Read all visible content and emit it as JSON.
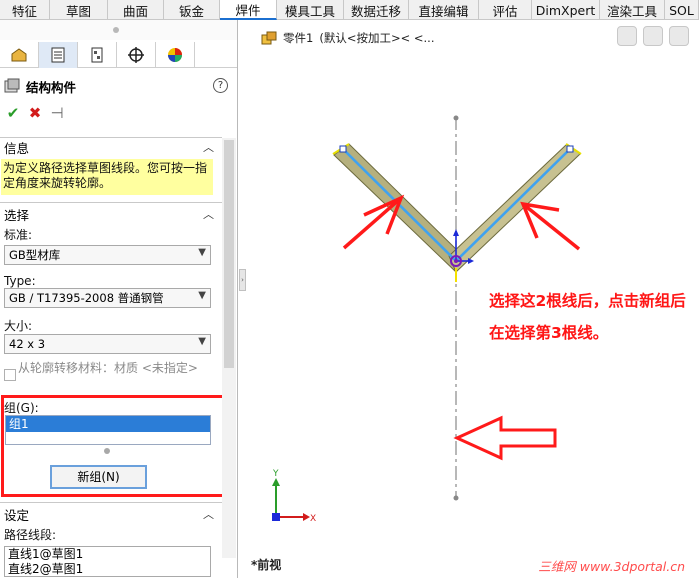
{
  "tabs": [
    "特征",
    "草图",
    "曲面",
    "钣金",
    "焊件",
    "模具工具",
    "数据迁移",
    "直接编辑",
    "评估",
    "DimXpert",
    "渲染工具",
    "SOL"
  ],
  "active_tab": "焊件",
  "property_manager": {
    "title": "结构构件",
    "help": "?",
    "ok": "✔",
    "cancel": "✖",
    "pin": "⊣",
    "info": {
      "header": "信息",
      "text": "为定义路径选择草图线段。您可按一指定角度来旋转轮廓。"
    },
    "selection": {
      "header": "选择",
      "standard_label": "标准:",
      "standard_value": "GB型材库",
      "type_label": "Type:",
      "type_value": "GB / T17395-2008 普通钢管",
      "size_label": "大小:",
      "size_value": "42 x 3",
      "transfer_label": "从轮廓转移材料：材质 <未指定>",
      "group_label": "组(G):",
      "groups": [
        "组1"
      ],
      "new_group_button": "新组(N)"
    },
    "settings": {
      "header": "设定",
      "path_label": "路径线段:",
      "path_items": [
        "直线1@草图1",
        "直线2@草图1"
      ]
    }
  },
  "graphics": {
    "breadcrumb_part": "零件1",
    "breadcrumb_config": "(默认<按加工>< <...",
    "annotation": "选择这2根线后，点击新组后在选择第3根线。",
    "view_name": "*前视",
    "watermark": "三维网 www.3dportal.cn",
    "axis_y": "Y",
    "axis_x": "X"
  },
  "colors": {
    "accent": "#1b6fd0",
    "annot": "#ff1616",
    "pipe": "#b5b07e",
    "path": "#3fa2f0",
    "info_bg": "#ffff9f"
  }
}
